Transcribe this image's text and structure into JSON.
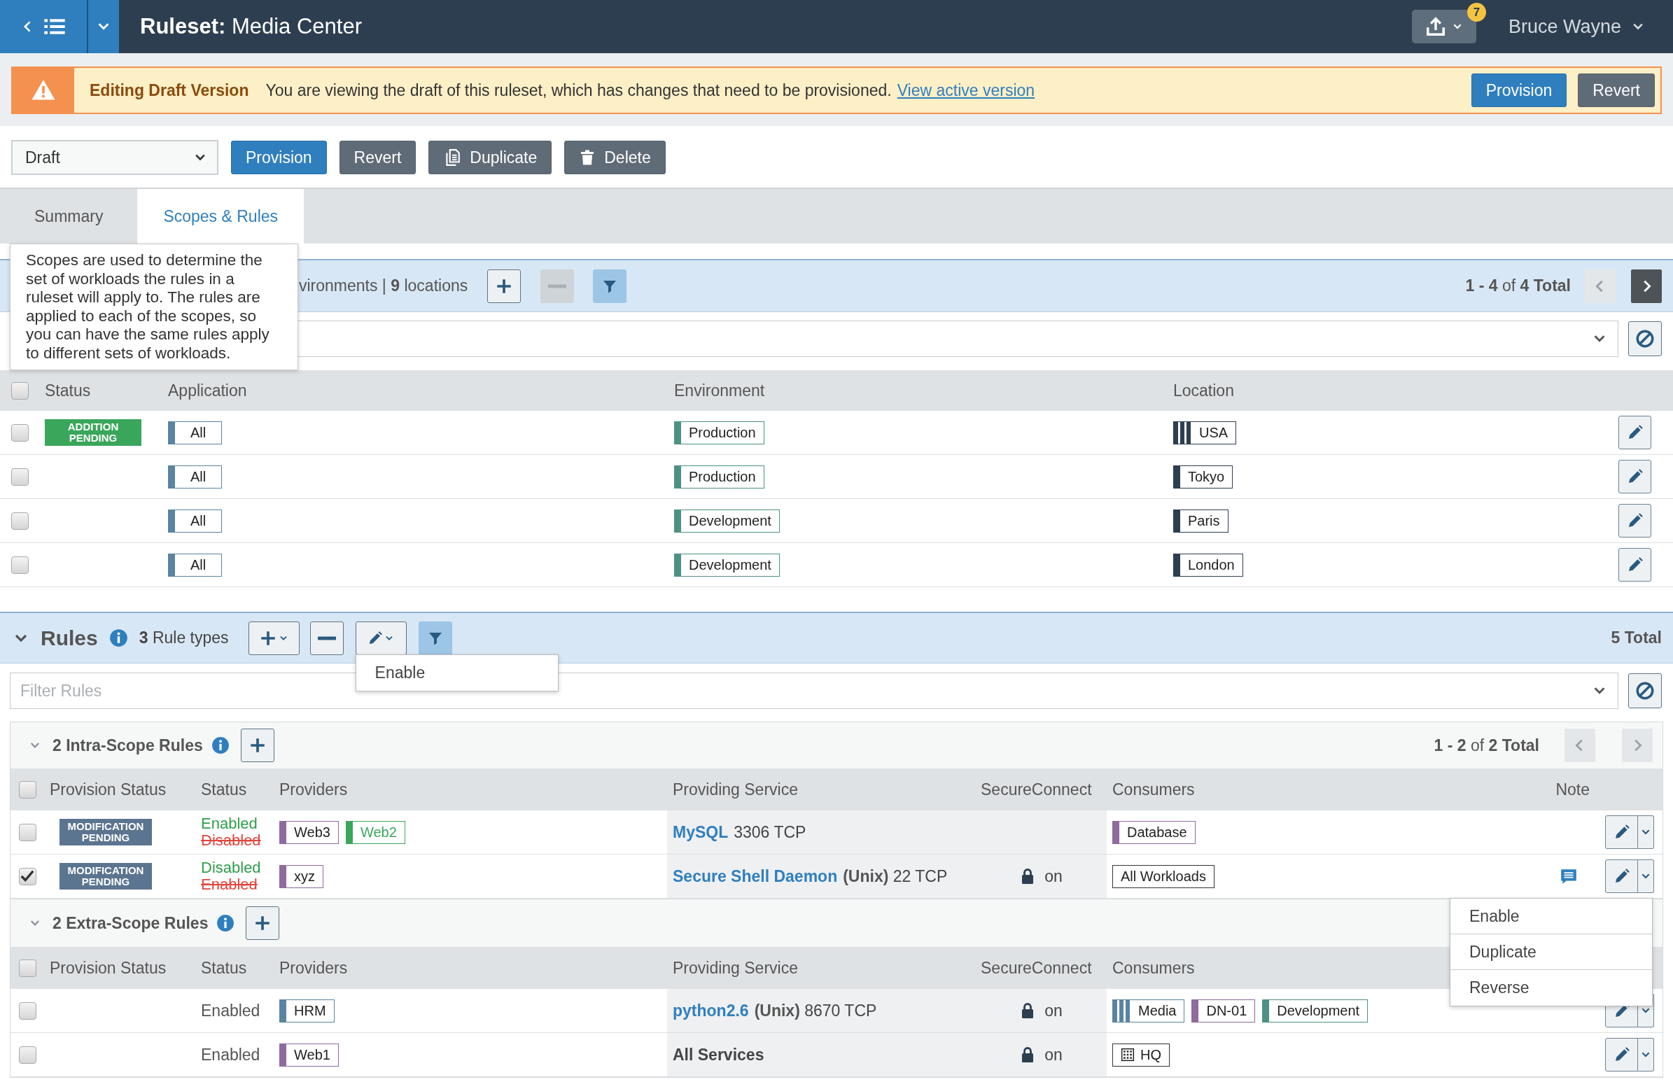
{
  "header": {
    "title": "**Ruleset:** Media Center",
    "badge": "7",
    "user": "Bruce Wayne"
  },
  "banner": {
    "title": "Editing Draft Version",
    "message": "You are viewing the draft of this ruleset, which has changes that need to be provisioned.",
    "link": "View active version",
    "buttons": [
      {
        "label": "Provision",
        "kind": "primary"
      },
      {
        "label": "Revert",
        "kind": "secondary"
      }
    ]
  },
  "toolbar": {
    "version": "Draft",
    "buttons": [
      {
        "label": "Provision",
        "kind": "primary"
      },
      {
        "label": "Revert",
        "kind": "secondary"
      },
      {
        "label": "Duplicate",
        "kind": "duplicate"
      },
      {
        "label": "Delete",
        "kind": "delete"
      }
    ]
  },
  "tabs": [
    {
      "label": "Summary",
      "selected": false
    },
    {
      "label": "Scopes & Rules",
      "selected": true
    }
  ],
  "tooltip": "Scopes are used to determine the set of workloads the rules in a ruleset will apply to. The rules are applied to each of the scopes, so you can have the same rules apply to different sets of workloads.",
  "scopes": {
    "summary": "vironments | **9** locations",
    "remove_disabled": true,
    "pagination": "**1 - 4** of **4 Total**",
    "prev_disabled": true,
    "next_disabled": false,
    "header_checked": false,
    "columns": [
      "Status",
      "Application",
      "Environment",
      "Location"
    ],
    "rows": [
      {
        "checked": false,
        "status": "ADDITION PENDING",
        "application": {
          "text": "All",
          "kind": "app"
        },
        "environment": {
          "text": "Production",
          "kind": "env"
        },
        "location": {
          "text": "USA",
          "kind": "loc_group"
        }
      },
      {
        "checked": false,
        "application": {
          "text": "All",
          "kind": "app"
        },
        "environment": {
          "text": "Production",
          "kind": "env"
        },
        "location": {
          "text": "Tokyo",
          "kind": "loc"
        }
      },
      {
        "checked": false,
        "application": {
          "text": "All",
          "kind": "app"
        },
        "environment": {
          "text": "Development",
          "kind": "env"
        },
        "location": {
          "text": "Paris",
          "kind": "loc"
        }
      },
      {
        "checked": false,
        "application": {
          "text": "All",
          "kind": "app"
        },
        "environment": {
          "text": "Development",
          "kind": "env"
        },
        "location": {
          "text": "London",
          "kind": "loc"
        }
      }
    ]
  },
  "rules": {
    "title": "Rules",
    "summary": "**3** Rule types",
    "remove_disabled": false,
    "edit_menu": [
      "Enable"
    ],
    "total": "5 Total",
    "filter_placeholder": "Filter Rules",
    "groups": [
      {
        "title": "2 Intra-Scope Rules",
        "pagination": "**1 - 2** of **2 Total**",
        "prev_disabled": true,
        "next_disabled": true,
        "header_checked": false,
        "columns": [
          "Provision Status",
          "Status",
          "Providers",
          "Providing Service",
          "SecureConnect",
          "Consumers",
          "Note"
        ],
        "rows": [
          {
            "checked": false,
            "provision_status": "MODIFICATION PENDING",
            "status": "Enabled",
            "previous_status": "Disabled",
            "providers": [
              {
                "text": "Web3",
                "kind": "role"
              },
              {
                "text": "Web2",
                "kind": "role_added"
              }
            ],
            "service": {
              "name": "MySQL",
              "detail": "3306 TCP",
              "kind": "link"
            },
            "consumers": [
              {
                "text": "Database",
                "kind": "role"
              }
            ],
            "note": false
          },
          {
            "checked": true,
            "provision_status": "MODIFICATION PENDING",
            "status": "Disabled",
            "previous_status": "Enabled",
            "providers": [
              {
                "text": "xyz",
                "kind": "role"
              }
            ],
            "service": {
              "name": "Secure Shell Daemon",
              "detail": "**(Unix)** 22 TCP",
              "kind": "link"
            },
            "secure": "on",
            "consumers": [
              {
                "text": "All Workloads",
                "kind": "all"
              }
            ],
            "note": true,
            "menu": [
              "Enable",
              "Duplicate",
              "Reverse"
            ]
          }
        ]
      },
      {
        "title": "2 Extra-Scope Rules",
        "header_checked": false,
        "columns": [
          "Provision Status",
          "Status",
          "Providers",
          "Providing Service",
          "SecureConnect",
          "Consumers"
        ],
        "rows": [
          {
            "checked": false,
            "status": "Enabled",
            "providers": [
              {
                "text": "HRM",
                "kind": "app"
              }
            ],
            "service": {
              "name": "python2.6",
              "detail": "**(Unix)** 8670 TCP",
              "kind": "link"
            },
            "secure": "on",
            "consumers": [
              {
                "text": "Media",
                "kind": "app_group"
              },
              {
                "text": "DN-01",
                "kind": "role"
              },
              {
                "text": "Development",
                "kind": "env"
              }
            ],
            "note": false
          },
          {
            "checked": false,
            "status": "Enabled",
            "providers": [
              {
                "text": "Web1",
                "kind": "role"
              }
            ],
            "service": {
              "name": "All Services",
              "kind": "all"
            },
            "secure": "on",
            "consumers": [
              {
                "text": "HQ",
                "kind": "iplist"
              }
            ],
            "note": false
          }
        ]
      }
    ]
  }
}
